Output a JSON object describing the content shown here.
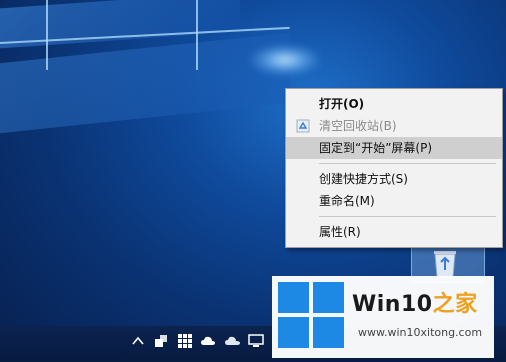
{
  "context_menu": {
    "items": [
      {
        "label": "打开(O)",
        "bold": true,
        "disabled": false
      },
      {
        "label": "清空回收站(B)",
        "bold": false,
        "disabled": true,
        "icon": "recycle-icon"
      },
      {
        "label": "固定到“开始”屏幕(P)",
        "bold": false,
        "disabled": false,
        "highlighted": true
      },
      {
        "label": "创建快捷方式(S)",
        "bold": false,
        "disabled": false
      },
      {
        "label": "重命名(M)",
        "bold": false,
        "disabled": false
      },
      {
        "label": "属性(R)",
        "bold": false,
        "disabled": false
      }
    ]
  },
  "desktop_icon": {
    "icon": "recycle-bin-icon"
  },
  "watermark": {
    "title_main": "Win10",
    "title_accent": "之家",
    "url": "www.win10xitong.com",
    "colors": {
      "logo": "#1e88e5",
      "accent": "#f0a020"
    }
  },
  "taskbar": {
    "tray_icons": [
      "chevron-up-icon",
      "network-drive-icon",
      "grid-app-icon",
      "cloud-icon",
      "onedrive-icon",
      "display-icon"
    ]
  }
}
